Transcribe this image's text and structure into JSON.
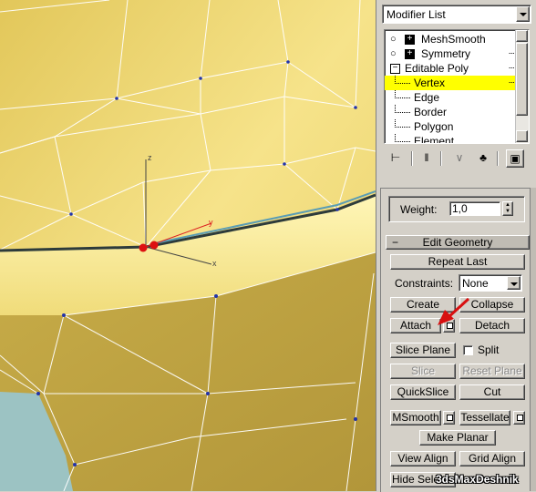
{
  "modifier_list": {
    "label": "Modifier List"
  },
  "stack": {
    "items": [
      {
        "label": "MeshSmooth",
        "icon": "lightbulb-icon"
      },
      {
        "label": "Symmetry",
        "icon": "lightbulb-icon"
      },
      {
        "label": "Editable Poly",
        "icon": "minus-expander-icon"
      },
      {
        "label": "Vertex",
        "selected": true
      },
      {
        "label": "Edge"
      },
      {
        "label": "Border"
      },
      {
        "label": "Polygon"
      },
      {
        "label": "Element"
      }
    ]
  },
  "toolbar_icons": [
    "pin-stack-icon",
    "show-end-result-icon",
    "make-unique-icon",
    "remove-modifier-icon",
    "configure-sets-icon"
  ],
  "weight": {
    "label": "Weight:",
    "value": "1,0"
  },
  "edit_geometry": {
    "header": "Edit Geometry",
    "expander": "−",
    "repeat_last": "Repeat Last",
    "constraints_label": "Constraints:",
    "constraints_value": "None",
    "create": "Create",
    "collapse": "Collapse",
    "attach": "Attach",
    "detach": "Detach",
    "slice_plane": "Slice Plane",
    "split": "Split",
    "slice": "Slice",
    "reset_plane": "Reset Plane",
    "quickslice": "QuickSlice",
    "cut": "Cut",
    "msmooth": "MSmooth",
    "tessellate": "Tessellate",
    "make_planar": "Make Planar",
    "view_align": "View Align",
    "grid_align": "Grid Align",
    "hide_selected": "Hide Selected"
  },
  "viewport": {
    "axis_x": "x",
    "axis_y": "y",
    "axis_z": "z"
  },
  "watermark": "3dsMaxDeshnik",
  "colors": {
    "mesh": "#e8cf66",
    "selection": "#ffff00",
    "vertex": "#dd1111",
    "background_teal": "#9cc3c3"
  }
}
